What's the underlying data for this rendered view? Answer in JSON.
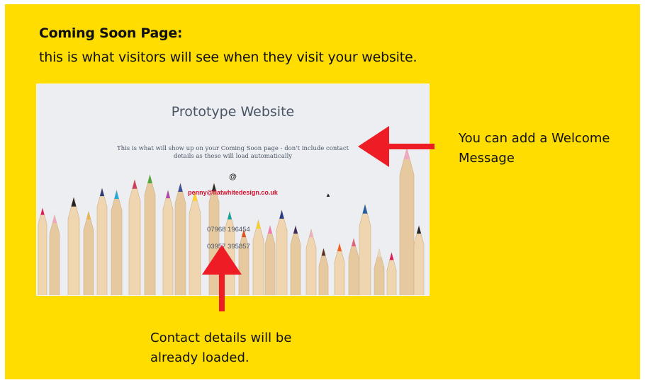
{
  "slide": {
    "heading": "Coming Soon Page:",
    "subheading": "this is what visitors will see when they visit your website."
  },
  "preview": {
    "title": "Prototype Website",
    "message_line1": "This is what will show up on your Coming Soon page - don't include contact",
    "message_line2": "details as these will load automatically",
    "at_symbol": "@",
    "email": "penny@flatwhitedesign.co.uk",
    "phone1": "07968 196454",
    "phone2": "03957 395857"
  },
  "callouts": {
    "welcome_line1": "You can add a Welcome",
    "welcome_line2": "Message",
    "contact_line1": "Contact details will be",
    "contact_line2": "already loaded."
  },
  "colors": {
    "background": "#ffdd00",
    "arrow": "#ee1c25",
    "email": "#d8102c"
  },
  "icons": {
    "arrow_left": "arrow-left-icon",
    "arrow_up": "arrow-up-icon",
    "cursor": "mouse-pointer-icon"
  }
}
